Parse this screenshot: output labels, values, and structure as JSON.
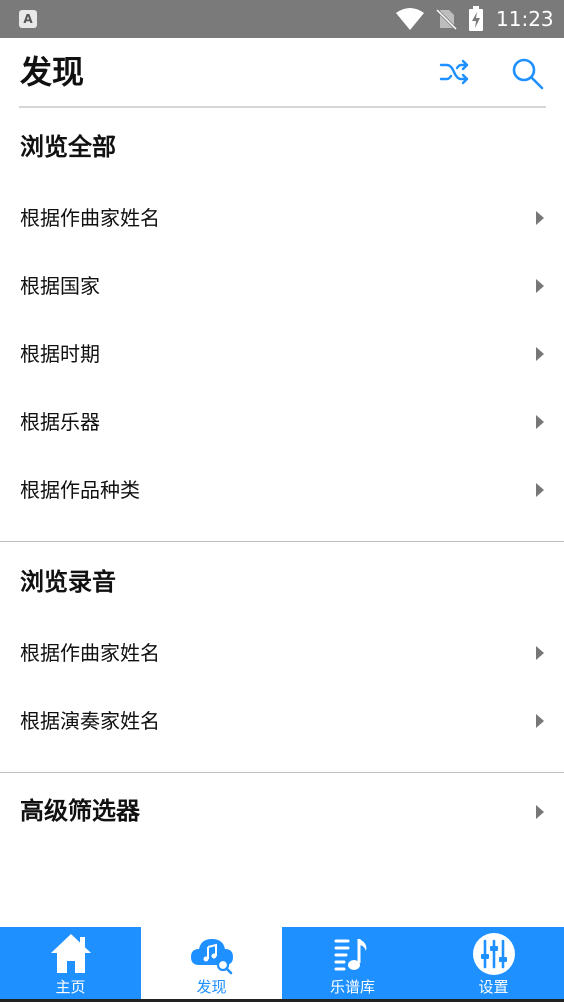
{
  "status_bar": {
    "app_indicator": "A",
    "time": "11:23",
    "icons": [
      "wifi-icon",
      "no-sim-icon",
      "battery-charging-icon"
    ]
  },
  "header": {
    "title": "发现",
    "actions": [
      "shuffle-icon",
      "search-icon"
    ],
    "accent_color": "#1e90ff"
  },
  "browse_all": {
    "title": "浏览全部",
    "items": [
      {
        "label": "根据作曲家姓名"
      },
      {
        "label": "根据国家"
      },
      {
        "label": "根据时期"
      },
      {
        "label": "根据乐器"
      },
      {
        "label": "根据作品种类"
      }
    ]
  },
  "browse_recordings": {
    "title": "浏览录音",
    "items": [
      {
        "label": "根据作曲家姓名"
      },
      {
        "label": "根据演奏家姓名"
      }
    ]
  },
  "advanced_filter": {
    "label": "高级筛选器"
  },
  "bottom_nav": {
    "active_index": 1,
    "items": [
      {
        "label": "主页",
        "icon": "home-icon"
      },
      {
        "label": "发现",
        "icon": "cloud-music-search-icon"
      },
      {
        "label": "乐谱库",
        "icon": "sheet-music-icon"
      },
      {
        "label": "设置",
        "icon": "sliders-icon"
      }
    ]
  }
}
